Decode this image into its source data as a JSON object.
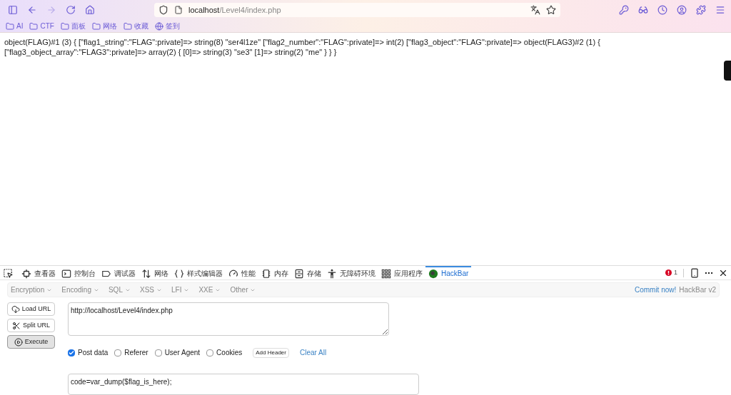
{
  "browser": {
    "url_host": "localhost",
    "url_path": "/Level4/index.php",
    "bookmarks": [
      {
        "kind": "folder",
        "label": "AI"
      },
      {
        "kind": "folder",
        "label": "CTF"
      },
      {
        "kind": "folder",
        "label": "面板"
      },
      {
        "kind": "folder",
        "label": "网络"
      },
      {
        "kind": "folder",
        "label": "收藏"
      },
      {
        "kind": "globe",
        "label": "签到"
      }
    ]
  },
  "page": {
    "text": "object(FLAG)#1 (3) { [\"flag1_string\":\"FLAG\":private]=> string(8) \"ser4l1ze\" [\"flag2_number\":\"FLAG\":private]=> int(2) [\"flag3_object\":\"FLAG\":private]=> object(FLAG3)#2 (1) { [\"flag3_object_array\":\"FLAG3\":private]=> array(2) { [0]=> string(3) \"se3\" [1]=> string(2) \"me\" } } }"
  },
  "devtools": {
    "tabs": [
      {
        "label": "查看器",
        "selected": false
      },
      {
        "label": "控制台",
        "selected": false
      },
      {
        "label": "调试器",
        "selected": false
      },
      {
        "label": "网络",
        "selected": false
      },
      {
        "label": "样式编辑器",
        "selected": false
      },
      {
        "label": "性能",
        "selected": false
      },
      {
        "label": "内存",
        "selected": false
      },
      {
        "label": "存储",
        "selected": false
      },
      {
        "label": "无障碍环境",
        "selected": false
      },
      {
        "label": "应用程序",
        "selected": false
      },
      {
        "label": "HackBar",
        "selected": true
      }
    ],
    "error_count": "1"
  },
  "hackbar": {
    "menus": [
      "Encryption",
      "Encoding",
      "SQL",
      "XSS",
      "LFI",
      "XXE",
      "Other"
    ],
    "commit_link": "Commit now!",
    "version": "HackBar v2",
    "buttons": [
      {
        "label": "Load URL",
        "selected": false
      },
      {
        "label": "Split URL",
        "selected": false
      },
      {
        "label": "Execute",
        "selected": true
      }
    ],
    "url": "http://localhost/Level4/index.php",
    "options": [
      {
        "label": "Post data",
        "checked": true
      },
      {
        "label": "Referer",
        "checked": false
      },
      {
        "label": "User Agent",
        "checked": false
      },
      {
        "label": "Cookies",
        "checked": false
      }
    ],
    "add_header": "Add Header",
    "clear_all": "Clear All",
    "post_body": "code=var_dump($flag_is_here);"
  }
}
